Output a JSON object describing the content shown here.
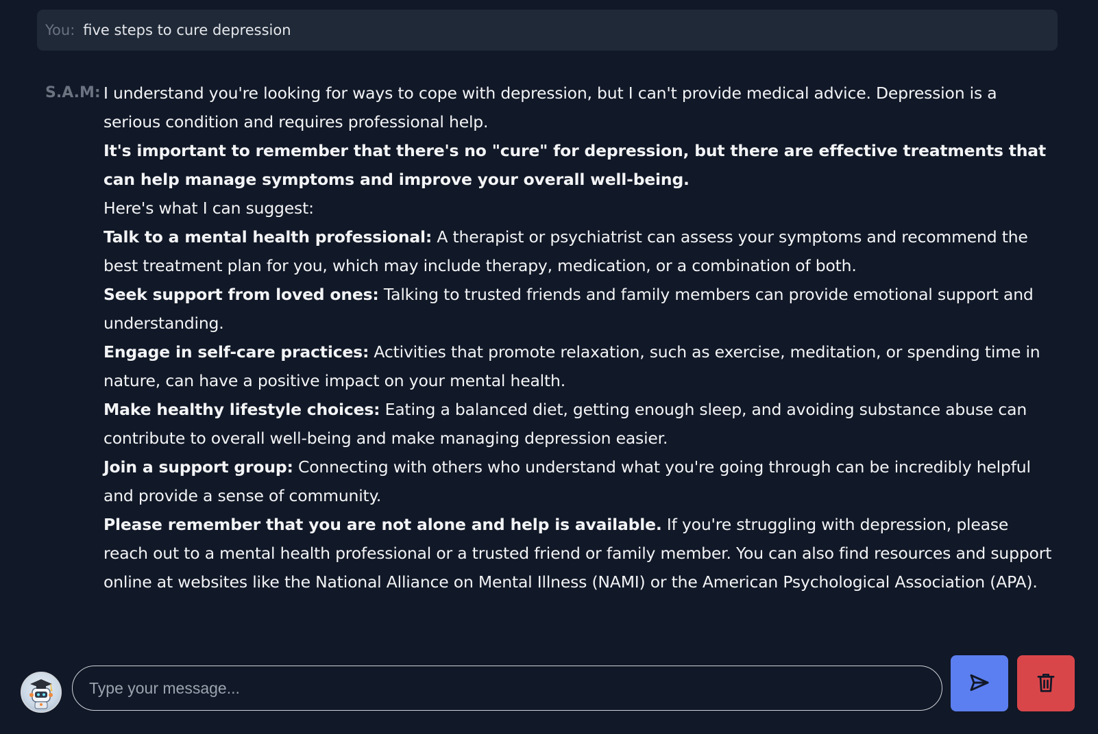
{
  "user_message": {
    "speaker": "You:",
    "text": "five steps to cure depression"
  },
  "bot_message": {
    "speaker": "S.A.M:",
    "intro": "I understand you're looking for ways to cope with depression, but I can't provide medical advice. Depression is a serious condition and requires professional help.",
    "important_note": "It's important to remember that there's no \"cure\" for depression, but there are effective treatments that can help manage symptoms and improve your overall well-being.",
    "suggest_line": "Here's what I can suggest:",
    "steps": [
      {
        "title": "Talk to a mental health professional:",
        "text": " A therapist or psychiatrist can assess your symptoms and recommend the best treatment plan for you, which may include therapy, medication, or a combination of both."
      },
      {
        "title": "Seek support from loved ones:",
        "text": " Talking to trusted friends and family members can provide emotional support and understanding."
      },
      {
        "title": "Engage in self-care practices:",
        "text": " Activities that promote relaxation, such as exercise, meditation, or spending time in nature, can have a positive impact on your mental health."
      },
      {
        "title": "Make healthy lifestyle choices:",
        "text": " Eating a balanced diet, getting enough sleep, and avoiding substance abuse can contribute to overall well-being and make managing depression easier."
      },
      {
        "title": "Join a support group:",
        "text": " Connecting with others who understand what you're going through can be incredibly helpful and provide a sense of community."
      }
    ],
    "closing": {
      "title": "Please remember that you are not alone and help is available.",
      "text": " If you're struggling with depression, please reach out to a mental health professional or a trusted friend or family member. You can also find resources and support online at websites like the National Alliance on Mental Illness (NAMI) or the American Psychological Association (APA)."
    }
  },
  "composer": {
    "placeholder": "Type your message...",
    "value": "",
    "avatar_icon": "robot-graduate-avatar-icon",
    "send_icon": "send-icon",
    "delete_icon": "trash-icon"
  },
  "colors": {
    "background": "#111827",
    "user_bubble": "#1f2937",
    "send_button": "#5b7ff0",
    "delete_button": "#d9464a",
    "speaker_label": "#6b7280"
  }
}
